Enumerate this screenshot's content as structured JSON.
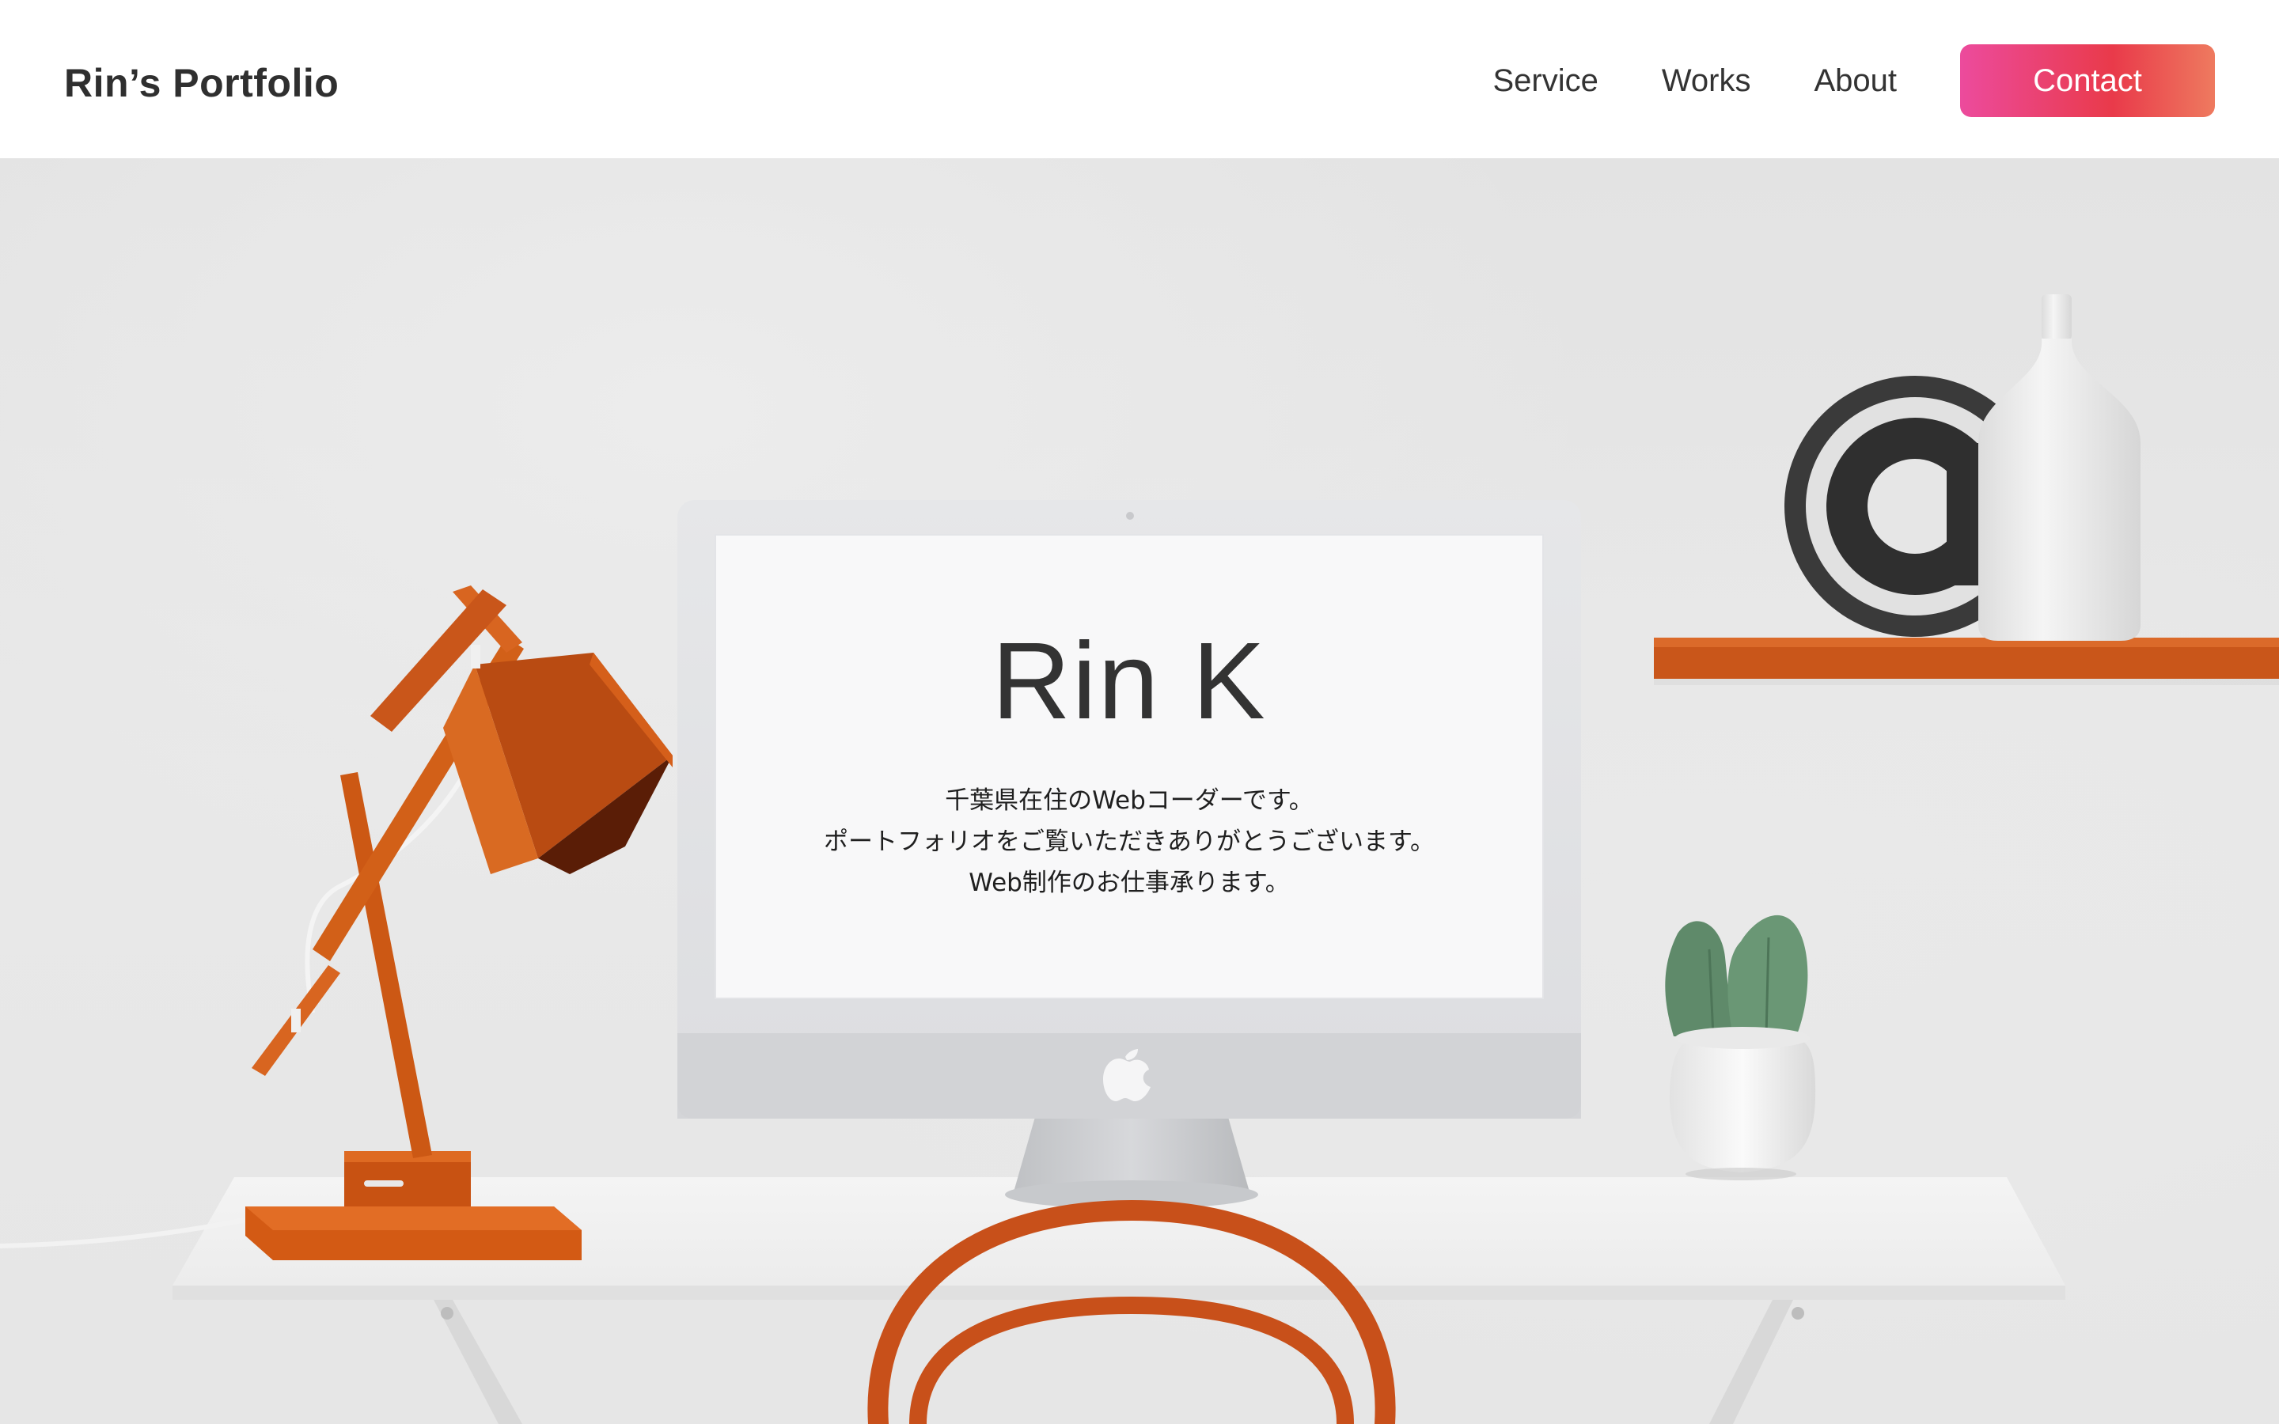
{
  "header": {
    "brand": "Rin’s Portfolio",
    "nav": {
      "service": "Service",
      "works": "Works",
      "about": "About",
      "contact": "Contact"
    }
  },
  "hero": {
    "name": "Rin K",
    "intro_lines": [
      "千葉県在住のWebコーダーです。",
      "ポートフォリオをご覧いただきありがとうございます。",
      "Web制作のお仕事承ります。"
    ]
  },
  "colors": {
    "accent_pink": "#ec4b9d",
    "accent_red": "#e93a4a",
    "accent_coral": "#ee7a5f",
    "lamp_orange": "#d35a14",
    "text_dark": "#333333"
  },
  "icons": [
    "apple-logo-icon",
    "at-sign-decoration"
  ]
}
